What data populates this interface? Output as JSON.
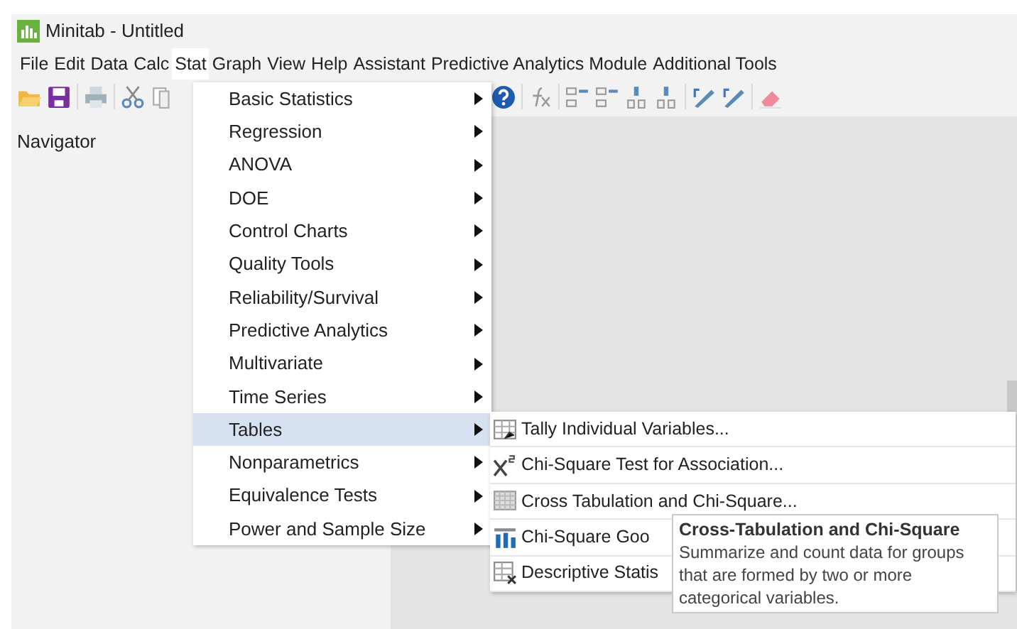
{
  "window": {
    "title": "Minitab - Untitled"
  },
  "menu_bar": [
    {
      "label": "File",
      "selected": false
    },
    {
      "label": "Edit",
      "selected": false
    },
    {
      "label": "Data",
      "selected": false
    },
    {
      "label": "Calc",
      "selected": false
    },
    {
      "label": "Stat",
      "selected": true
    },
    {
      "label": "Graph",
      "selected": false
    },
    {
      "label": "View",
      "selected": false
    },
    {
      "label": "Help",
      "selected": false
    },
    {
      "label": "Assistant",
      "selected": false
    },
    {
      "label": "Predictive Analytics Module",
      "selected": false
    },
    {
      "label": "Additional Tools",
      "selected": false
    }
  ],
  "toolbar": [
    {
      "kind": "open"
    },
    {
      "kind": "save"
    },
    {
      "kind": "sep"
    },
    {
      "kind": "print"
    },
    {
      "kind": "sep"
    },
    {
      "kind": "cut"
    },
    {
      "kind": "copy"
    },
    {
      "kind": "help"
    },
    {
      "kind": "sep"
    },
    {
      "kind": "function"
    },
    {
      "kind": "sep"
    },
    {
      "kind": "rows"
    },
    {
      "kind": "rows"
    },
    {
      "kind": "cols"
    },
    {
      "kind": "cols"
    },
    {
      "kind": "sep"
    },
    {
      "kind": "pencil"
    },
    {
      "kind": "pencil"
    },
    {
      "kind": "sep"
    },
    {
      "kind": "eraser"
    }
  ],
  "navigator": {
    "title": "Navigator"
  },
  "stat_menu": [
    {
      "label": "Basic Statistics",
      "selected": false
    },
    {
      "label": "Regression",
      "selected": false
    },
    {
      "label": "ANOVA",
      "selected": false
    },
    {
      "label": "DOE",
      "selected": false
    },
    {
      "label": "Control Charts",
      "selected": false
    },
    {
      "label": "Quality Tools",
      "selected": false
    },
    {
      "label": "Reliability/Survival",
      "selected": false
    },
    {
      "label": "Predictive Analytics",
      "selected": false
    },
    {
      "label": "Multivariate",
      "selected": false
    },
    {
      "label": "Time Series",
      "selected": false
    },
    {
      "label": "Tables",
      "selected": true
    },
    {
      "label": "Nonparametrics",
      "selected": false
    },
    {
      "label": "Equivalence Tests",
      "selected": false
    },
    {
      "label": "Power and Sample Size",
      "selected": false
    }
  ],
  "tables_submenu": [
    {
      "label": "Tally Individual Variables...",
      "kind": "tally"
    },
    {
      "label": "Chi-Square Test for Association...",
      "kind": "chi"
    },
    {
      "label": "Cross Tabulation and Chi-Square...",
      "kind": "grid"
    },
    {
      "label": "Chi-Square Goo",
      "kind": "bars"
    },
    {
      "label": "Descriptive Statis",
      "kind": "table"
    }
  ],
  "tooltip": {
    "title": "Cross-Tabulation and Chi-Square",
    "text": "Summarize and count data for groups that are formed by two or more categorical variables."
  }
}
